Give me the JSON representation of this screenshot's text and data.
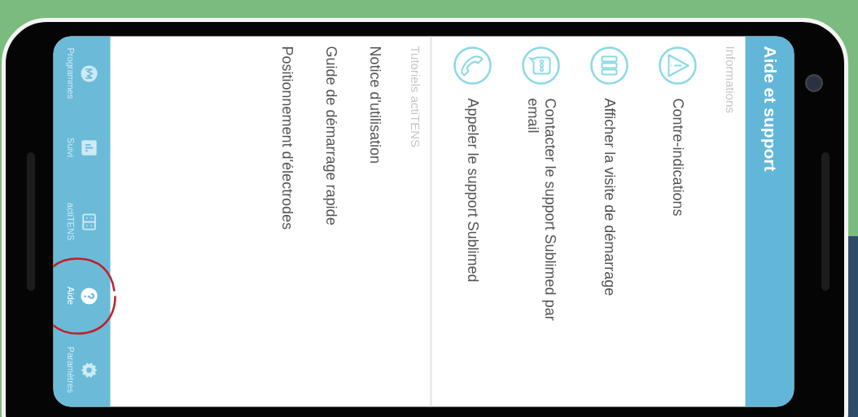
{
  "header": {
    "title": "Aide et support"
  },
  "sections": [
    {
      "title": "Informations",
      "items": [
        {
          "kind": "warning",
          "label": "Contre-indications"
        },
        {
          "kind": "device",
          "label": "Afficher la visite de démarrage"
        },
        {
          "kind": "chat",
          "label": "Contacter le support Sublimed par email"
        },
        {
          "kind": "phone",
          "label": "Appeler le support Sublimed"
        }
      ]
    },
    {
      "title": "Tutoriels actiTENS",
      "items": [
        {
          "label": "Notice d'utilisation"
        },
        {
          "label": "Guide de démarrage rapide"
        },
        {
          "label": "Positionnement d'électrodes"
        }
      ]
    }
  ],
  "nav": [
    {
      "kind": "programs",
      "label": "Programmes",
      "selected": false,
      "highlighted": false
    },
    {
      "kind": "stats",
      "label": "Suivi",
      "selected": false,
      "highlighted": false
    },
    {
      "kind": "device",
      "label": "actiTENS",
      "selected": false,
      "highlighted": false
    },
    {
      "kind": "help",
      "label": "Aide",
      "selected": true,
      "highlighted": true
    },
    {
      "kind": "settings",
      "label": "Paramètres",
      "selected": false,
      "highlighted": false
    }
  ]
}
